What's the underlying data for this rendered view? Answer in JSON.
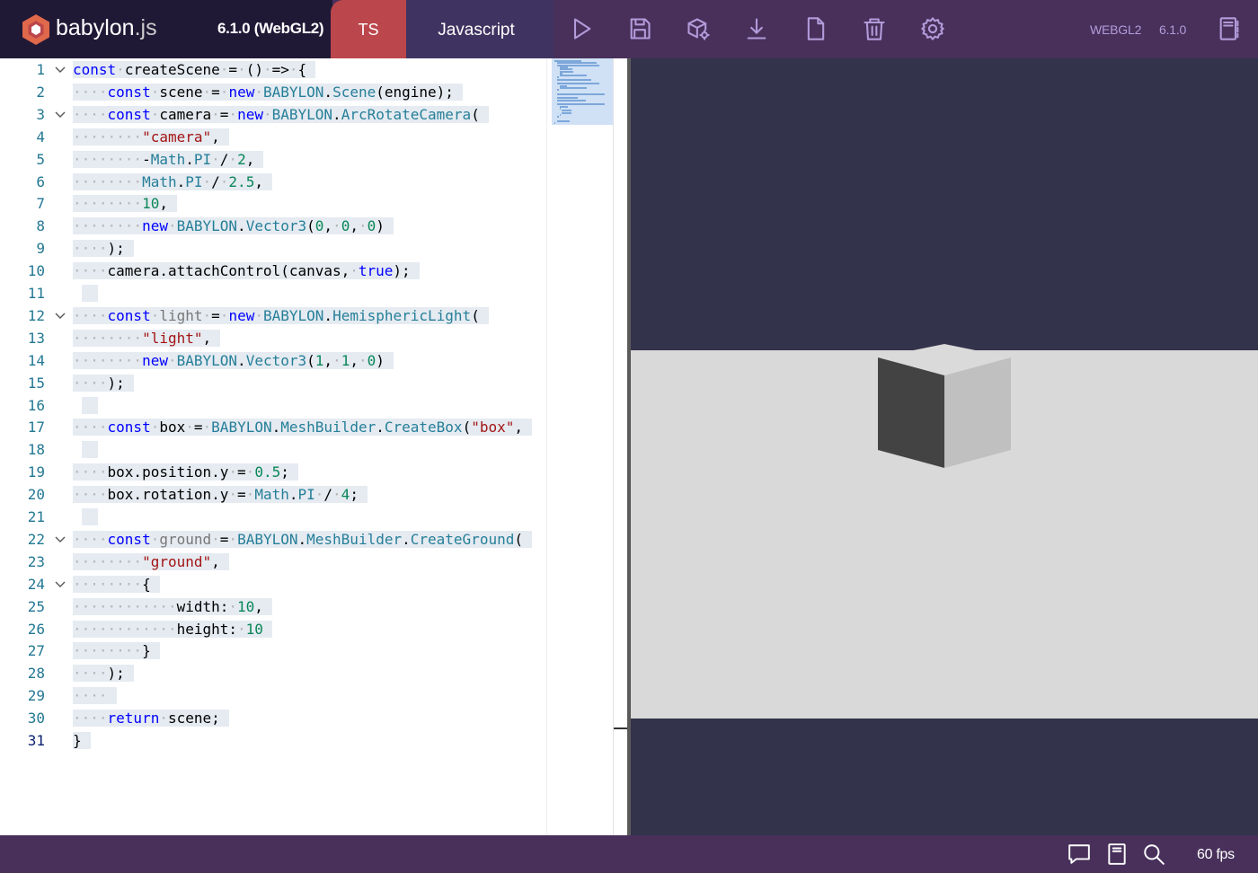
{
  "header": {
    "logo_text": "babylon",
    "logo_dot_text": ".js",
    "version_label": "6.1.0 (WebGL2)",
    "tab_ts": "TS",
    "tab_js": "Javascript",
    "engine_label": "WEBGL2",
    "engine_version": "6.1.0",
    "icons": [
      "play-icon",
      "save-icon",
      "examples-icon",
      "download-icon",
      "new-icon",
      "clear-icon",
      "settings-icon",
      "metadata-icon"
    ]
  },
  "editor": {
    "line_numbers": [
      "1",
      "2",
      "3",
      "4",
      "5",
      "6",
      "7",
      "8",
      "9",
      "10",
      "11",
      "12",
      "13",
      "14",
      "15",
      "16",
      "17",
      "18",
      "19",
      "20",
      "21",
      "22",
      "23",
      "24",
      "25",
      "26",
      "27",
      "28",
      "29",
      "30",
      "31"
    ],
    "current_line": "31",
    "code_lines": [
      "const createScene = () => {",
      "    const scene = new BABYLON.Scene(engine);",
      "    const camera = new BABYLON.ArcRotateCamera(",
      "        \"camera\",",
      "        -Math.PI / 2,",
      "        Math.PI / 2.5,",
      "        10,",
      "        new BABYLON.Vector3(0, 0, 0)",
      "    );",
      "    camera.attachControl(canvas, true);",
      "",
      "    const light = new BABYLON.HemisphericLight(",
      "        \"light\",",
      "        new BABYLON.Vector3(1, 1, 0)",
      "    );",
      "",
      "    const box = BABYLON.MeshBuilder.CreateBox(\"box\",",
      "",
      "    box.position.y = 0.5;",
      "    box.rotation.y = Math.PI / 4;",
      "",
      "    const ground = BABYLON.MeshBuilder.CreateGround(",
      "        \"ground\",",
      "        {",
      "            width: 10,",
      "            height: 10",
      "        }",
      "    );",
      "    ",
      "    return scene;",
      "}"
    ]
  },
  "footer": {
    "fps": "60 fps",
    "icons": [
      "feedback-icon",
      "docs-icon",
      "search-icon"
    ]
  },
  "colors": {
    "header_bg": "#48305b",
    "logo_bg": "#201936",
    "ts_tab": "#bb464b",
    "js_tab": "#3f3461",
    "viewport_bg": "#33334c",
    "ground": "#d9d9d9"
  }
}
